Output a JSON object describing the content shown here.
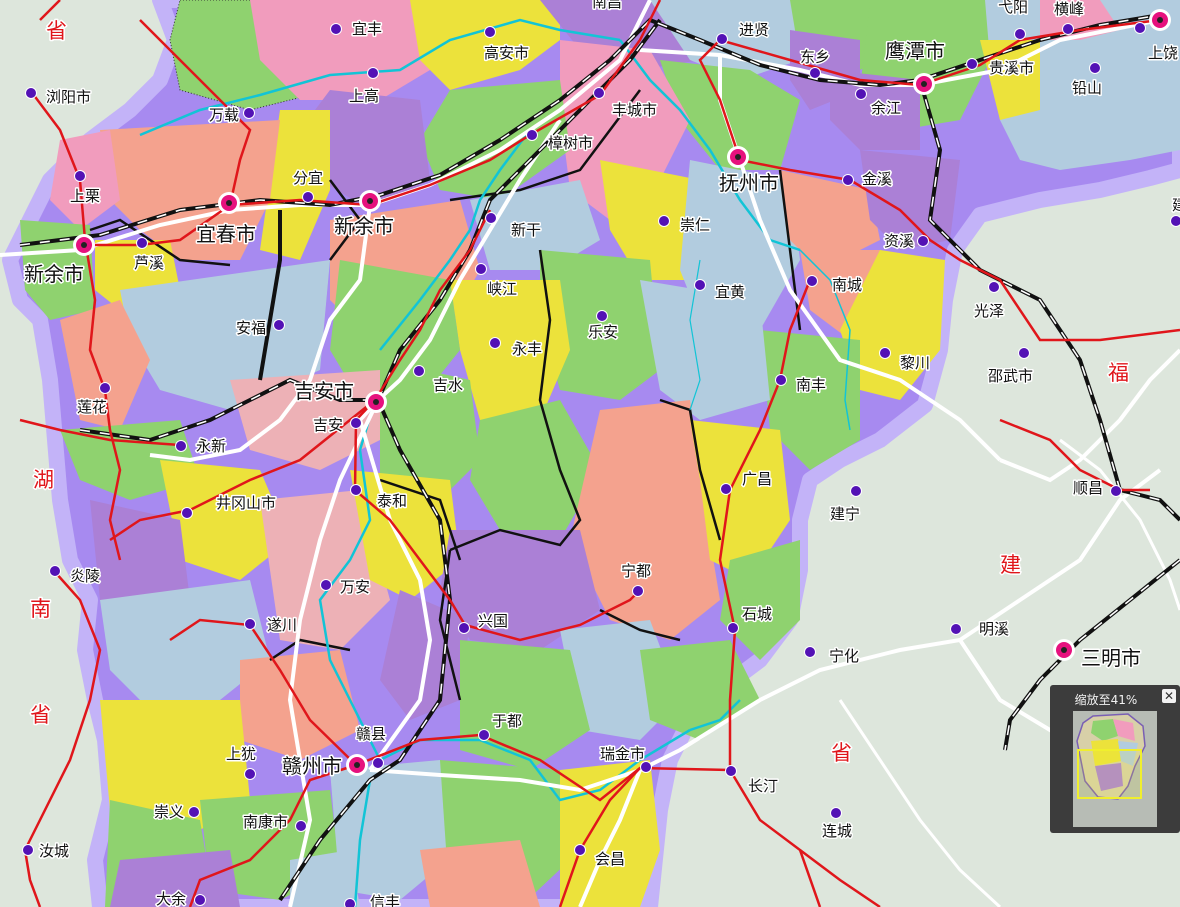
{
  "colors": {
    "background": "#dde6dc",
    "region_pink": "#f19cbd",
    "region_salmon": "#f4a28e",
    "region_purple": "#ab80d6",
    "region_blue": "#b2ccdf",
    "region_yellow": "#ece23b",
    "region_green": "#8fd26f",
    "border_glow": "#a78af0",
    "road": "#e0161b",
    "highway": "#ffffff",
    "railway": "#111111",
    "river": "#12c4d6",
    "province_label": "#e0161b",
    "city_marker": "#e6117e",
    "county_marker": "#5312b5"
  },
  "province_labels": [
    {
      "id": "jiangxi-n",
      "text": "省"
    },
    {
      "id": "hunan-1",
      "text": "湖"
    },
    {
      "id": "hunan-2",
      "text": "南"
    },
    {
      "id": "hunan-3",
      "text": "省"
    },
    {
      "id": "fujian-1",
      "text": "福"
    },
    {
      "id": "fujian-2",
      "text": "建"
    },
    {
      "id": "fujian-3",
      "text": "省"
    }
  ],
  "cities": [
    {
      "name": "宜春市"
    },
    {
      "name": "新余市"
    },
    {
      "name": "新余市"
    },
    {
      "name": "吉安市"
    },
    {
      "name": "抚州市"
    },
    {
      "name": "鹰潭市"
    },
    {
      "name": "赣州市"
    },
    {
      "name": "三明市"
    }
  ],
  "counties": [
    {
      "name": "南昌"
    },
    {
      "name": "宜丰"
    },
    {
      "name": "高安市"
    },
    {
      "name": "进贤"
    },
    {
      "name": "东乡"
    },
    {
      "name": "弋阳"
    },
    {
      "name": "横峰"
    },
    {
      "name": "上饶"
    },
    {
      "name": "浏阳市"
    },
    {
      "name": "上高"
    },
    {
      "name": "万载"
    },
    {
      "name": "丰城市"
    },
    {
      "name": "贵溪市"
    },
    {
      "name": "铅山"
    },
    {
      "name": "余江"
    },
    {
      "name": "樟树市"
    },
    {
      "name": "上栗"
    },
    {
      "name": "分宜"
    },
    {
      "name": "金溪"
    },
    {
      "name": "新干"
    },
    {
      "name": "崇仁"
    },
    {
      "name": "资溪"
    },
    {
      "name": "芦溪"
    },
    {
      "name": "南城"
    },
    {
      "name": "光泽"
    },
    {
      "name": "峡江"
    },
    {
      "name": "宜黄"
    },
    {
      "name": "安福"
    },
    {
      "name": "乐安"
    },
    {
      "name": "永丰"
    },
    {
      "name": "黎川"
    },
    {
      "name": "邵武市"
    },
    {
      "name": "南丰"
    },
    {
      "name": "吉水"
    },
    {
      "name": "莲花"
    },
    {
      "name": "吉安"
    },
    {
      "name": "永新"
    },
    {
      "name": "广昌"
    },
    {
      "name": "顺昌"
    },
    {
      "name": "泰和"
    },
    {
      "name": "建宁"
    },
    {
      "name": "井冈山市"
    },
    {
      "name": "炎陵"
    },
    {
      "name": "宁都"
    },
    {
      "name": "万安"
    },
    {
      "name": "石城"
    },
    {
      "name": "明溪"
    },
    {
      "name": "遂川"
    },
    {
      "name": "兴国"
    },
    {
      "name": "宁化"
    },
    {
      "name": "于都"
    },
    {
      "name": "赣县"
    },
    {
      "name": "上犹"
    },
    {
      "name": "瑞金市"
    },
    {
      "name": "长汀"
    },
    {
      "name": "崇义"
    },
    {
      "name": "南康市"
    },
    {
      "name": "连城"
    },
    {
      "name": "汝城"
    },
    {
      "name": "会昌"
    },
    {
      "name": "大余"
    },
    {
      "name": "信丰"
    },
    {
      "name": "建"
    }
  ],
  "overview_panel": {
    "title": "缩放至41%",
    "zoom_percent": 41,
    "close_icon": "close-icon"
  }
}
